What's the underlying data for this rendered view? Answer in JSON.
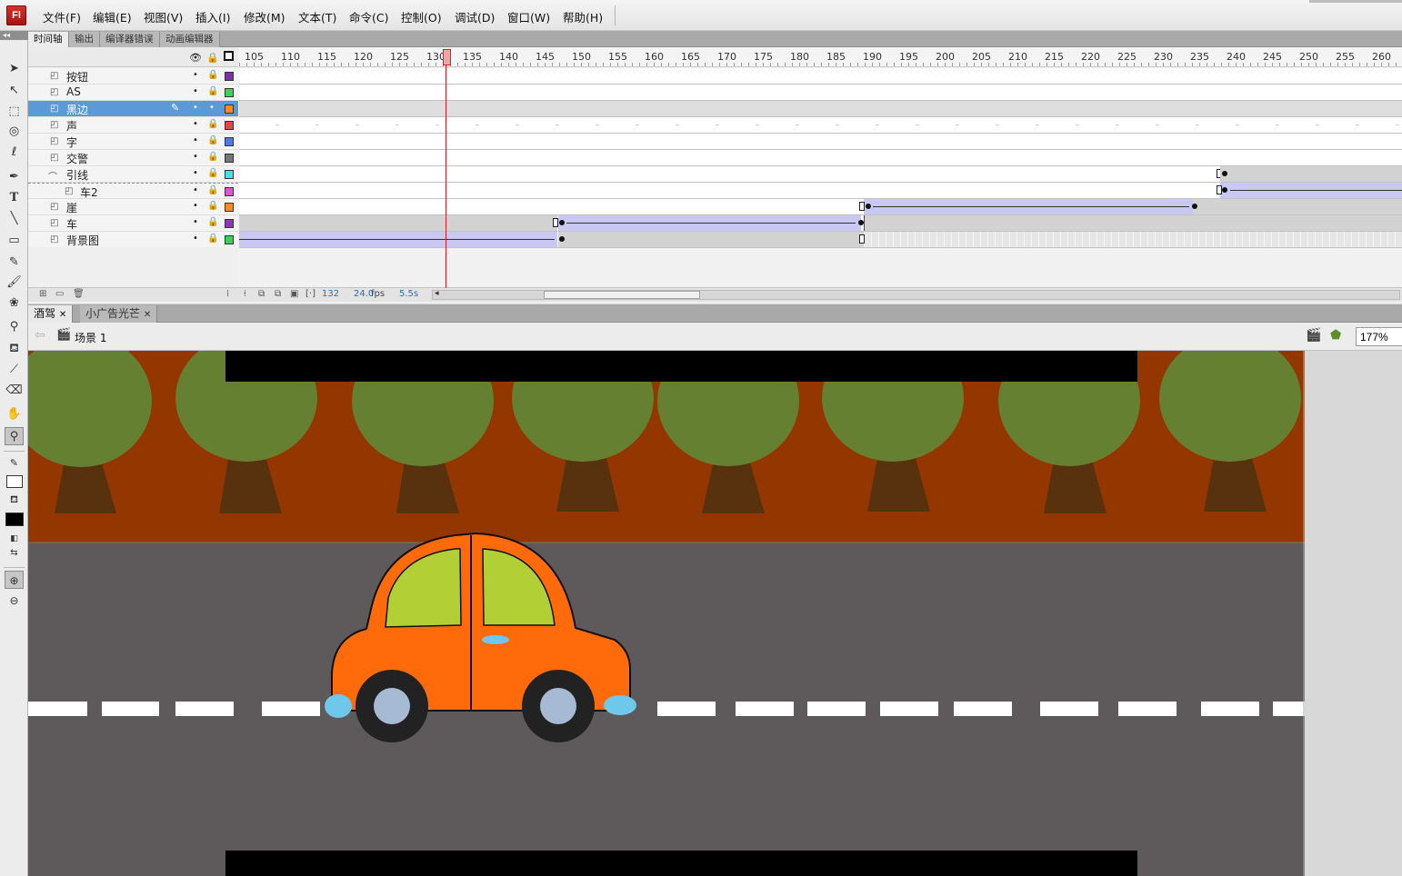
{
  "app": {
    "logo_text": "Fl"
  },
  "menu": [
    "文件(F)",
    "编辑(E)",
    "视图(V)",
    "插入(I)",
    "修改(M)",
    "文本(T)",
    "命令(C)",
    "控制(O)",
    "调试(D)",
    "窗口(W)",
    "帮助(H)"
  ],
  "toolbar": {
    "grip_label": "◂◂",
    "tools": [
      "selection-arrow-icon",
      "subselection-icon",
      "free-transform-icon",
      "3d-rotation-icon",
      "lasso-icon",
      "pen-icon",
      "text-icon",
      "line-icon",
      "rectangle-icon",
      "pencil-icon",
      "brush-icon",
      "deco-icon",
      "bone-icon",
      "paint-bucket-icon",
      "eyedropper-icon",
      "eraser-icon",
      "hand-icon",
      "zoom-icon"
    ]
  },
  "panel_tabs": [
    "时间轴",
    "输出",
    "编译器错误",
    "动画编辑器"
  ],
  "timeline": {
    "ruler_labels": [
      "105",
      "110",
      "115",
      "120",
      "125",
      "130",
      "135",
      "140",
      "145",
      "150",
      "155",
      "160",
      "165",
      "170",
      "175",
      "180",
      "185",
      "190",
      "195",
      "200",
      "205",
      "210",
      "215",
      "220",
      "225",
      "230",
      "235",
      "240",
      "245",
      "250",
      "255",
      "260"
    ],
    "layers": [
      {
        "name": "按钮",
        "color": "#7b2fa8",
        "type": "normal",
        "selected": false
      },
      {
        "name": "AS",
        "color": "#3fcf5a",
        "type": "normal",
        "selected": false
      },
      {
        "name": "黑边",
        "color": "#ff8a1f",
        "type": "normal",
        "selected": true
      },
      {
        "name": "声",
        "color": "#e64343",
        "type": "normal",
        "selected": false
      },
      {
        "name": "字",
        "color": "#4f79e6",
        "type": "normal",
        "selected": false
      },
      {
        "name": "交警",
        "color": "#777777",
        "type": "normal",
        "selected": false
      },
      {
        "name": "引线",
        "color": "#38e6e6",
        "type": "guide",
        "selected": false
      },
      {
        "name": "车2",
        "color": "#e64fd6",
        "type": "guided",
        "selected": false
      },
      {
        "name": "崖",
        "color": "#ff8a1f",
        "type": "normal",
        "selected": false
      },
      {
        "name": "车",
        "color": "#8a38b8",
        "type": "normal",
        "selected": false
      },
      {
        "name": "背景图",
        "color": "#3fcf5a",
        "type": "normal",
        "selected": false
      }
    ],
    "footer": {
      "current_frame": "132",
      "fps": "24.0",
      "fps_unit": "fps",
      "time": "5.5s"
    }
  },
  "doc_tabs": [
    "酒驾",
    "小广告光芒"
  ],
  "editbar": {
    "scene": "场景 1",
    "zoom": "177%"
  },
  "stage": {
    "colors": {
      "sky": "#933600",
      "road": "#5e5a5b",
      "tree_crown": "#658030",
      "tree_trunk": "#58320f",
      "car_body": "#ff6a0a",
      "window": "#b2cf35",
      "wheel": "#222222",
      "hubcap": "#a6bad4",
      "light": "#6ec8ec",
      "lane": "#ffffff",
      "letterbox": "#000000"
    }
  }
}
